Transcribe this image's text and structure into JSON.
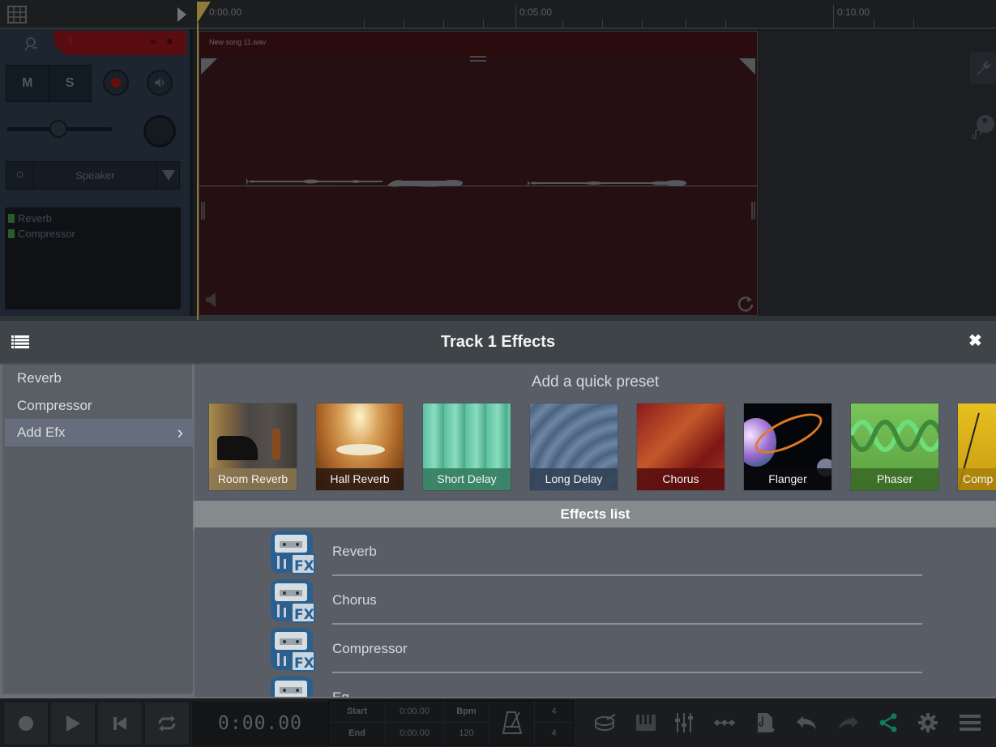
{
  "timeline": {
    "ticks": [
      "0:00.00",
      "0:05.00",
      "0:10.00"
    ]
  },
  "track": {
    "number": "1",
    "mute_label": "M",
    "solo_label": "S",
    "output_prefix": "O",
    "output_label": "Speaker",
    "effects": [
      {
        "name": "Reverb",
        "color": "#2c5a2c"
      },
      {
        "name": "Compressor",
        "color": "#2c5a2c"
      }
    ]
  },
  "clip": {
    "title": "New song  11.wav"
  },
  "side_tools": [
    {
      "icon": "wrench-icon"
    },
    {
      "icon": "music-globe-icon"
    }
  ],
  "panel": {
    "title": "Track 1 Effects",
    "menu_icon": "list-icon",
    "close_icon": "close-icon"
  },
  "sidebar": {
    "items": [
      {
        "label": "Reverb",
        "active": false
      },
      {
        "label": "Compressor",
        "active": false
      },
      {
        "label": "Add Efx",
        "active": true,
        "chevron": "›"
      }
    ]
  },
  "presets": {
    "title": "Add a quick preset",
    "items": [
      {
        "label": "Room Reverb"
      },
      {
        "label": "Hall Reverb"
      },
      {
        "label": "Short Delay"
      },
      {
        "label": "Long Delay"
      },
      {
        "label": "Chorus"
      },
      {
        "label": "Flanger"
      },
      {
        "label": "Phaser"
      },
      {
        "label": "Comp"
      }
    ]
  },
  "effects_list": {
    "title": "Effects list",
    "items": [
      {
        "label": "Reverb"
      },
      {
        "label": "Chorus"
      },
      {
        "label": "Compressor"
      },
      {
        "label": "Eq"
      }
    ]
  },
  "transport": {
    "time": "0:00.00",
    "start_label": "Start",
    "start_value": "0:00.00",
    "end_label": "End",
    "end_value": "0:00.00",
    "bpm_label": "Bpm",
    "bpm_value": "120",
    "sig_top": "4",
    "sig_bottom": "4",
    "accent_color": "#0f7a5e"
  }
}
